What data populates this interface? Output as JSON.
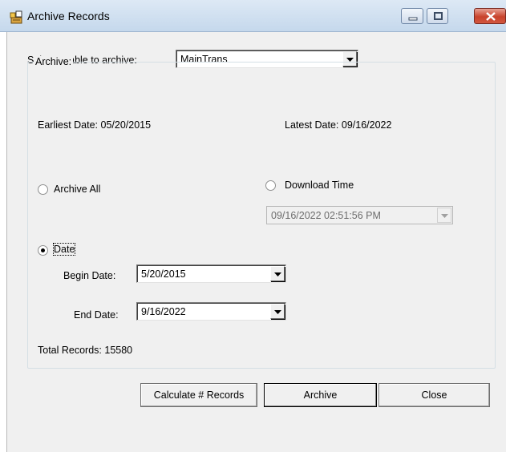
{
  "window": {
    "title": "Archive Records"
  },
  "table_select": {
    "label": "Select a table to archive:",
    "value": "MainTrans"
  },
  "archive_group": {
    "legend": "Archive:",
    "earliest_date": "Earliest Date: 05/20/2015",
    "latest_date": "Latest Date: 09/16/2022",
    "options": {
      "archive_all": {
        "label": "Archive All",
        "selected": false
      },
      "download_time": {
        "label": "Download Time",
        "selected": false,
        "value": "09/16/2022 02:51:56 PM"
      },
      "date": {
        "label": "Date",
        "selected": true
      }
    },
    "begin_date": {
      "label": "Begin Date:",
      "value": "5/20/2015"
    },
    "end_date": {
      "label": "End Date:",
      "value": "9/16/2022"
    },
    "total_records": "Total Records: 15580"
  },
  "buttons": {
    "calculate": "Calculate # Records",
    "archive": "Archive",
    "close": "Close"
  }
}
